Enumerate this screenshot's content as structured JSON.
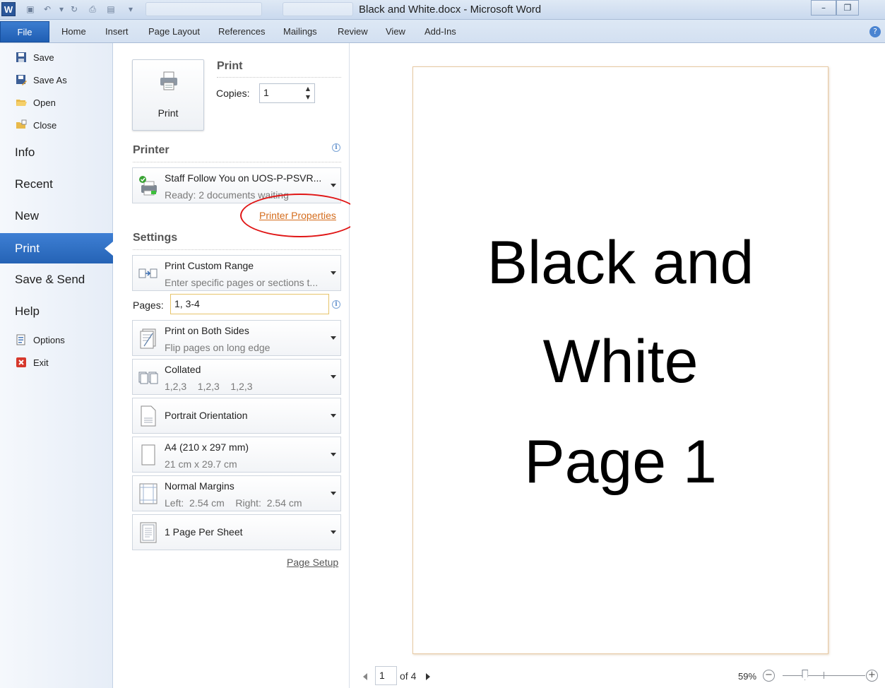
{
  "window": {
    "title": "Black and White.docx - Microsoft Word",
    "app_icon_letter": "W",
    "controls": {
      "minimize": "–",
      "restore": "❐"
    }
  },
  "ribbon": {
    "file_label": "File",
    "tabs": [
      "Home",
      "Insert",
      "Page Layout",
      "References",
      "Mailings",
      "Review",
      "View",
      "Add-Ins"
    ],
    "help_glyph": "?"
  },
  "nav": {
    "save": "Save",
    "save_as": "Save As",
    "open": "Open",
    "close": "Close",
    "info": "Info",
    "recent": "Recent",
    "new": "New",
    "print": "Print",
    "save_send": "Save & Send",
    "help": "Help",
    "options": "Options",
    "exit": "Exit"
  },
  "print_section": {
    "heading": "Print",
    "button_label": "Print",
    "copies_label": "Copies:",
    "copies_value": "1"
  },
  "printer": {
    "heading": "Printer",
    "name": "Staff Follow You on UOS-P-PSVR...",
    "status": "Ready: 2 documents waiting",
    "properties_link": "Printer Properties"
  },
  "settings": {
    "heading": "Settings",
    "range_title": "Print Custom Range",
    "range_sub": "Enter specific pages or sections t...",
    "pages_label": "Pages:",
    "pages_value": "1, 3-4",
    "sides_title": "Print on Both Sides",
    "sides_sub": "Flip pages on long edge",
    "collate_title": "Collated",
    "collate_sub": "1,2,3    1,2,3    1,2,3",
    "orientation": "Portrait Orientation",
    "paper_title": "A4 (210 x 297 mm)",
    "paper_sub": "21 cm x 29.7 cm",
    "margins_title": "Normal Margins",
    "margins_sub": "Left:  2.54 cm    Right:  2.54 cm",
    "per_sheet": "1 Page Per Sheet",
    "page_setup_link": "Page Setup"
  },
  "preview": {
    "lines": [
      "Black and",
      "White",
      "Page 1"
    ],
    "current_page": "1",
    "of_pages": "of 4",
    "zoom": "59%",
    "zoom_level": 0.59,
    "zoom_minus": "−",
    "zoom_plus": "+"
  },
  "colors": {
    "file_tab": "#2563b5",
    "nav_selected": "#3e7fd4",
    "link_orange": "#d46c1c",
    "annotation_red": "#e01515",
    "pages_field_border": "#e6c46a"
  }
}
